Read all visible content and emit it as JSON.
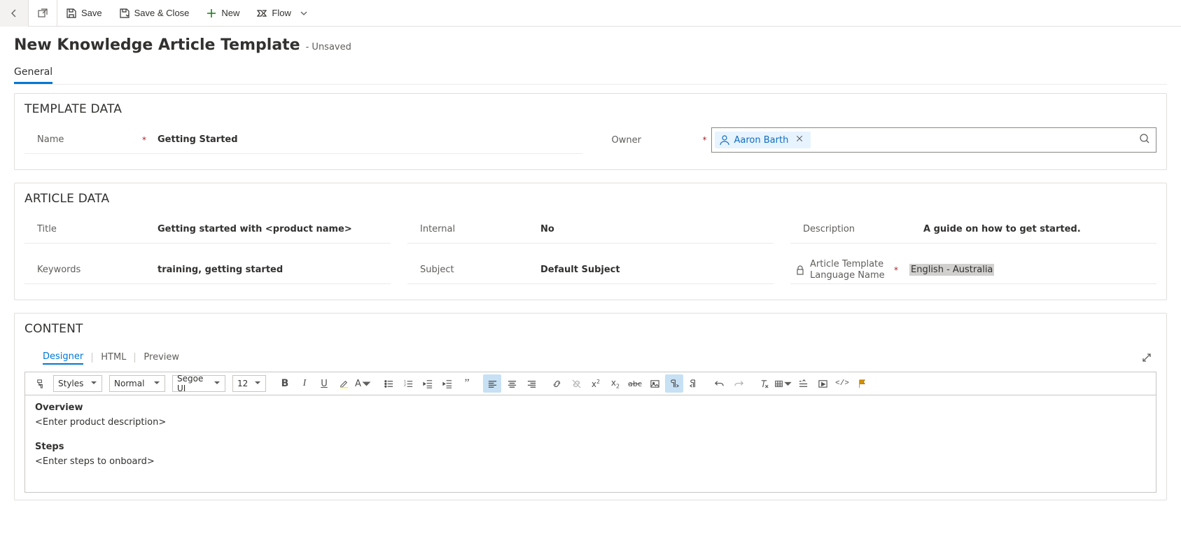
{
  "commands": {
    "save": "Save",
    "save_close": "Save & Close",
    "new": "New",
    "flow": "Flow"
  },
  "header": {
    "title": "New Knowledge Article Template",
    "suffix": "- Unsaved"
  },
  "tabs": {
    "general": "General"
  },
  "sections": {
    "template": "TEMPLATE DATA",
    "article": "ARTICLE DATA",
    "content": "CONTENT"
  },
  "template_data": {
    "name_label": "Name",
    "name_value": "Getting Started",
    "owner_label": "Owner",
    "owner_value": "Aaron Barth"
  },
  "article_data": {
    "title_label": "Title",
    "title_value": "Getting started with <product name>",
    "keywords_label": "Keywords",
    "keywords_value": "training, getting started",
    "internal_label": "Internal",
    "internal_value": "No",
    "subject_label": "Subject",
    "subject_value": "Default Subject",
    "description_label": "Description",
    "description_value": "A guide on how to get started.",
    "lang_label": "Article Template Language Name",
    "lang_value": "English - Australia"
  },
  "editor": {
    "subtabs": {
      "designer": "Designer",
      "html": "HTML",
      "preview": "Preview"
    },
    "toolbar": {
      "styles": "Styles",
      "format": "Normal",
      "font": "Segoe UI",
      "size": "12"
    },
    "body": {
      "h1": "Overview",
      "p1": "<Enter product description>",
      "h2": "Steps",
      "p2": "<Enter steps to onboard>"
    }
  }
}
